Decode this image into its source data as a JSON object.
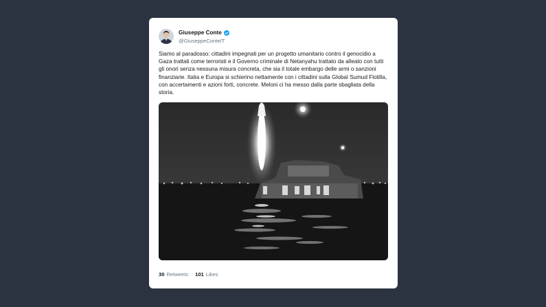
{
  "author": {
    "display_name": "Giuseppe Conte",
    "handle": "@GiuseppeConteIT",
    "verified": true,
    "avatar_icon": "user-avatar-photo",
    "verified_icon": "verified-badge-icon"
  },
  "tweet": {
    "text": "Siamo al paradosso: cittadini impegnati per un progetto umanitario contro il genocidio a Gaza trattati come terroristi e il Governo criminale di Netanyahu trattato da alleato con tutti gli onori senza nessuna misura concreta, che sia il totale embargo delle armi o sanzioni finanziarie. Italia e Europa si schierino nettamente con i cittadini sulla Global Sumud Flotilla, con accertamenti e azioni forti, concrete. Meloni ci ha messo dalla parte sbagliata della storia."
  },
  "media": {
    "kind": "photo",
    "icon": "night-boat-flare-photo"
  },
  "stats": {
    "retweets_count": "30",
    "retweets_label": "Retweets",
    "likes_count": "101",
    "likes_label": "Likes"
  },
  "colors": {
    "page_background": "#2c3340",
    "card_background": "#ffffff",
    "text_primary": "#14171a",
    "text_secondary": "#657786",
    "verified_blue": "#1da1f2"
  }
}
